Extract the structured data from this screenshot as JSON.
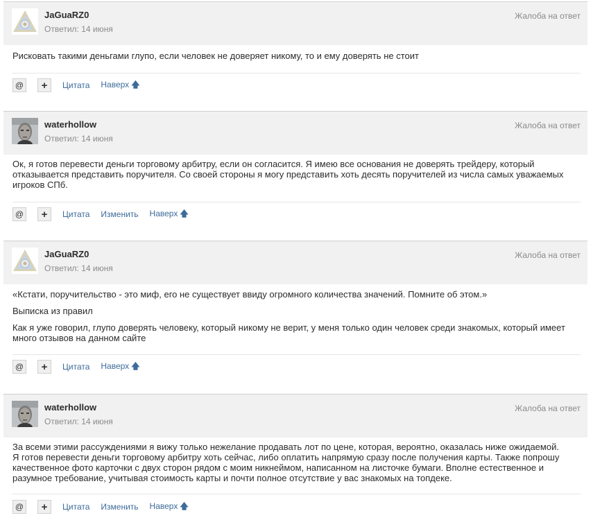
{
  "common": {
    "report_label": "Жалоба на ответ",
    "at_label": "@",
    "plus_label": "+",
    "quote_label": "Цитата",
    "edit_label": "Изменить",
    "up_label": "Наверх",
    "up_arrow": "🡅",
    "arrow_char": "▲"
  },
  "posts": [
    {
      "author": "JaGuaRZ0",
      "answered": "Ответил: 14 июня",
      "avatar": "triangle-logo",
      "paragraphs": [
        "Рисковать такими деньгами глупо, если человек не доверяет никому, то и ему доверять не стоит"
      ],
      "has_edit": false
    },
    {
      "author": "waterhollow",
      "answered": "Ответил: 14 июня",
      "avatar": "face-photo",
      "paragraphs": [
        "Ок, я готов перевести деньги торговому арбитру, если он согласится. Я имею все основания не доверять трейдеру, который отказывается представить поручителя. Со своей стороны я могу представить хоть десять поручителей из числа самых уважаемых игроков СПб."
      ],
      "has_edit": true
    },
    {
      "author": "JaGuaRZ0",
      "answered": "Ответил: 14 июня",
      "avatar": "triangle-logo",
      "paragraphs": [
        "«Кстати, поручительство - это миф, его не существует ввиду огромного количества значений. Помните об этом.»",
        "Выписка из правил",
        "Как я уже говорил, глупо доверять человеку, который никому не верит, у меня только один человек среди знакомых, который имеет много отзывов на данном сайте"
      ],
      "has_edit": false
    },
    {
      "author": "waterhollow",
      "answered": "Ответил: 14 июня",
      "avatar": "face-photo",
      "paragraphs": [
        "За всеми этими рассуждениями я вижу только нежелание продавать лот по цене, которая, вероятно, оказалась ниже ожидаемой. Я готов перевести деньги торговому арбитру хоть сейчас, либо оплатить напрямую сразу после получения карты. Также попрошу качественное фото карточки с двух сторон рядом с моим никнеймом, написанном на листочке бумаги. Вполне естественное и разумное требование, учитывая стоимость карты и почти полное отсутствие у вас знакомых на топдеке."
      ],
      "has_edit": true
    }
  ]
}
